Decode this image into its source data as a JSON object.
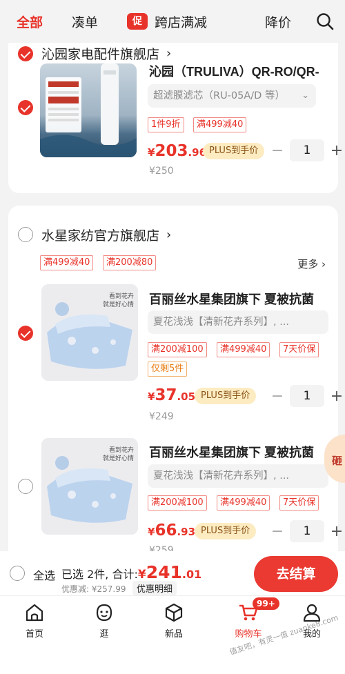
{
  "tabs": [
    {
      "label": "全部",
      "active": true
    },
    {
      "label": "凑单",
      "active": false
    },
    {
      "label": "跨店满减",
      "badge": "促",
      "active": false
    },
    {
      "label": "降价",
      "active": false
    }
  ],
  "shops": [
    {
      "name": "沁园家电配件旗舰店",
      "checked": true,
      "items": [
        {
          "title": "沁园（TRULIVA）QR-RO/QR-",
          "spec": "超滤膜滤芯（RU-05A/D 等）",
          "tags": [
            "1件9折",
            "满499减40"
          ],
          "price_currency": "¥",
          "price_int": "203",
          "price_dec": ".96",
          "plus_label": "PLUS到手价",
          "qty": "1",
          "orig_price": "¥250",
          "checked": true
        }
      ]
    },
    {
      "name": "水星家纺官方旗舰店",
      "checked": false,
      "shop_tags": [
        "满499减40",
        "满200减80"
      ],
      "more_label": "更多 ›",
      "items": [
        {
          "title": "百丽丝水星集团旗下 夏被抗菌",
          "spec": "夏花浅浅【清新花卉系列】, ...",
          "tags": [
            "满200减100",
            "满499减40",
            "7天价保"
          ],
          "stock_tag": "仅剩5件",
          "price_currency": "¥",
          "price_int": "37",
          "price_dec": ".05",
          "plus_label": "PLUS到手价",
          "qty": "1",
          "orig_price": "¥249",
          "img_caption": "看到花卉\n就是好心情",
          "checked": true
        },
        {
          "title": "百丽丝水星集团旗下 夏被抗菌",
          "spec": "夏花浅浅【清新花卉系列】, ...",
          "tags": [
            "满200减100",
            "满499减40",
            "7天价保"
          ],
          "price_currency": "¥",
          "price_int": "66",
          "price_dec": ".93",
          "plus_label": "PLUS到手价",
          "qty": "1",
          "orig_price": "¥259",
          "img_caption": "看到花卉\n就是好心情",
          "checked": false
        }
      ]
    }
  ],
  "float_badge": "砸",
  "checkout": {
    "select_all_label": "全选",
    "selected_text": "已选 2件, 合计:",
    "total_currency": "¥",
    "total_int": "241",
    "total_dec": ".01",
    "saved_text": "优惠减: ¥257.99",
    "detail_label": "优惠明细",
    "pay_label": "去结算"
  },
  "nav": [
    {
      "label": "首页",
      "icon": "home-icon"
    },
    {
      "label": "逛",
      "icon": "browse-icon"
    },
    {
      "label": "新品",
      "icon": "box-icon"
    },
    {
      "label": "购物车",
      "icon": "cart-icon",
      "badge": "99+",
      "active": true
    },
    {
      "label": "我的",
      "icon": "profile-icon"
    }
  ],
  "watermark": "值友吧，有灵一值 zuanke8.com",
  "colors": {
    "accent": "#e8332a",
    "plus_bg": "#fdecc2",
    "page_bg": "#f3f3f3"
  }
}
